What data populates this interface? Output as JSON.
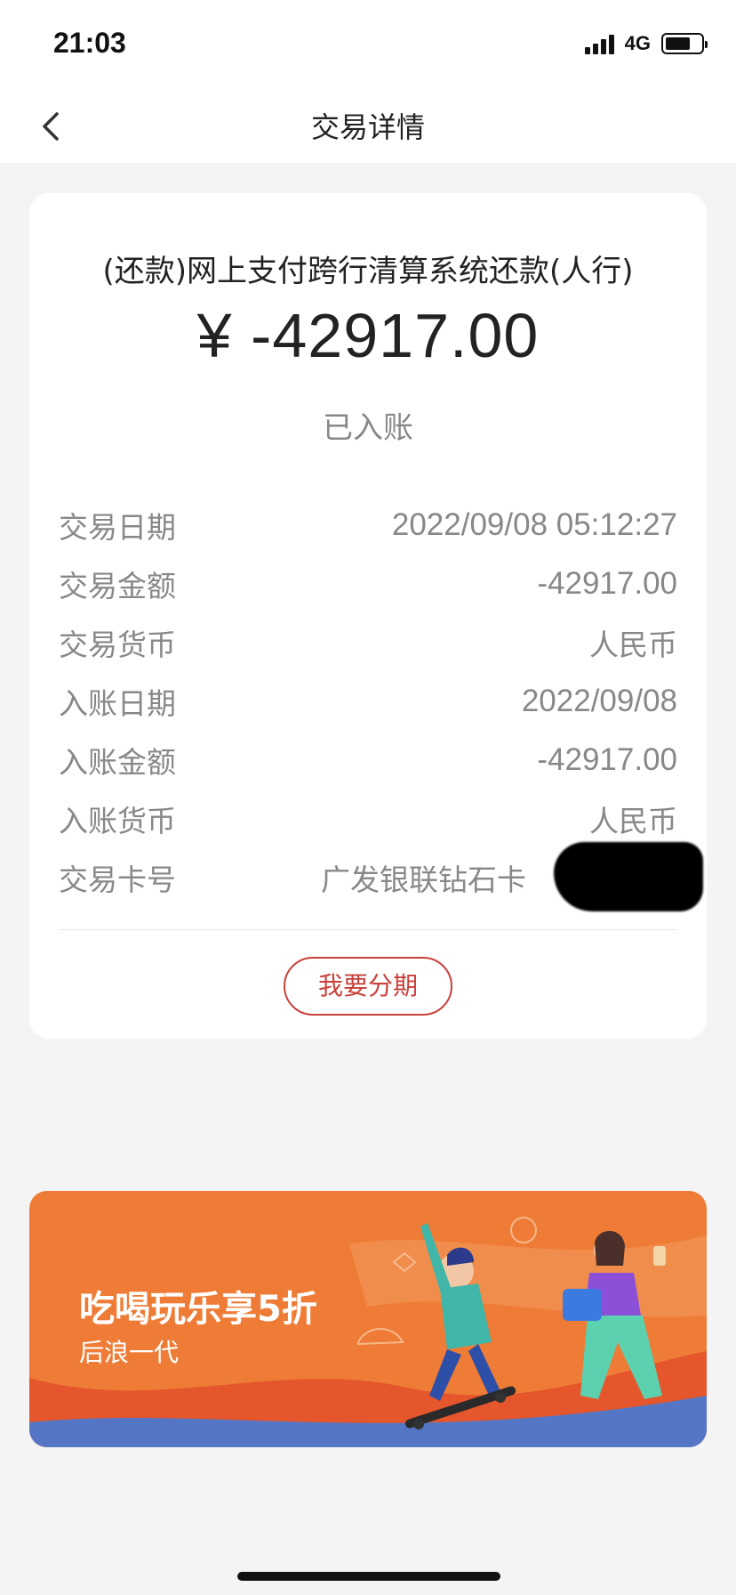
{
  "status_bar": {
    "time": "21:03",
    "network": "4G",
    "battery_level": 0.7
  },
  "nav": {
    "title": "交易详情",
    "back_icon": "chevron-left-icon"
  },
  "transaction": {
    "title": "(还款)网上支付跨行清算系统还款(人行)",
    "amount": "¥ -42917.00",
    "status": "已入账",
    "details": [
      {
        "label": "交易日期",
        "value": "2022/09/08 05:12:27"
      },
      {
        "label": "交易金额",
        "value": "-42917.00"
      },
      {
        "label": "交易货币",
        "value": "人民币"
      },
      {
        "label": "入账日期",
        "value": "2022/09/08"
      },
      {
        "label": "入账金额",
        "value": "-42917.00"
      },
      {
        "label": "入账货币",
        "value": "人民币"
      },
      {
        "label": "交易卡号",
        "value": "广发银联钻石卡"
      }
    ],
    "installment_button": "我要分期"
  },
  "banner": {
    "title": "吃喝玩乐享5折",
    "subtitle": "后浪一代",
    "background": "#ee7c36"
  },
  "colors": {
    "accent_red": "#c8403a",
    "page_bg": "#f4f4f4"
  }
}
